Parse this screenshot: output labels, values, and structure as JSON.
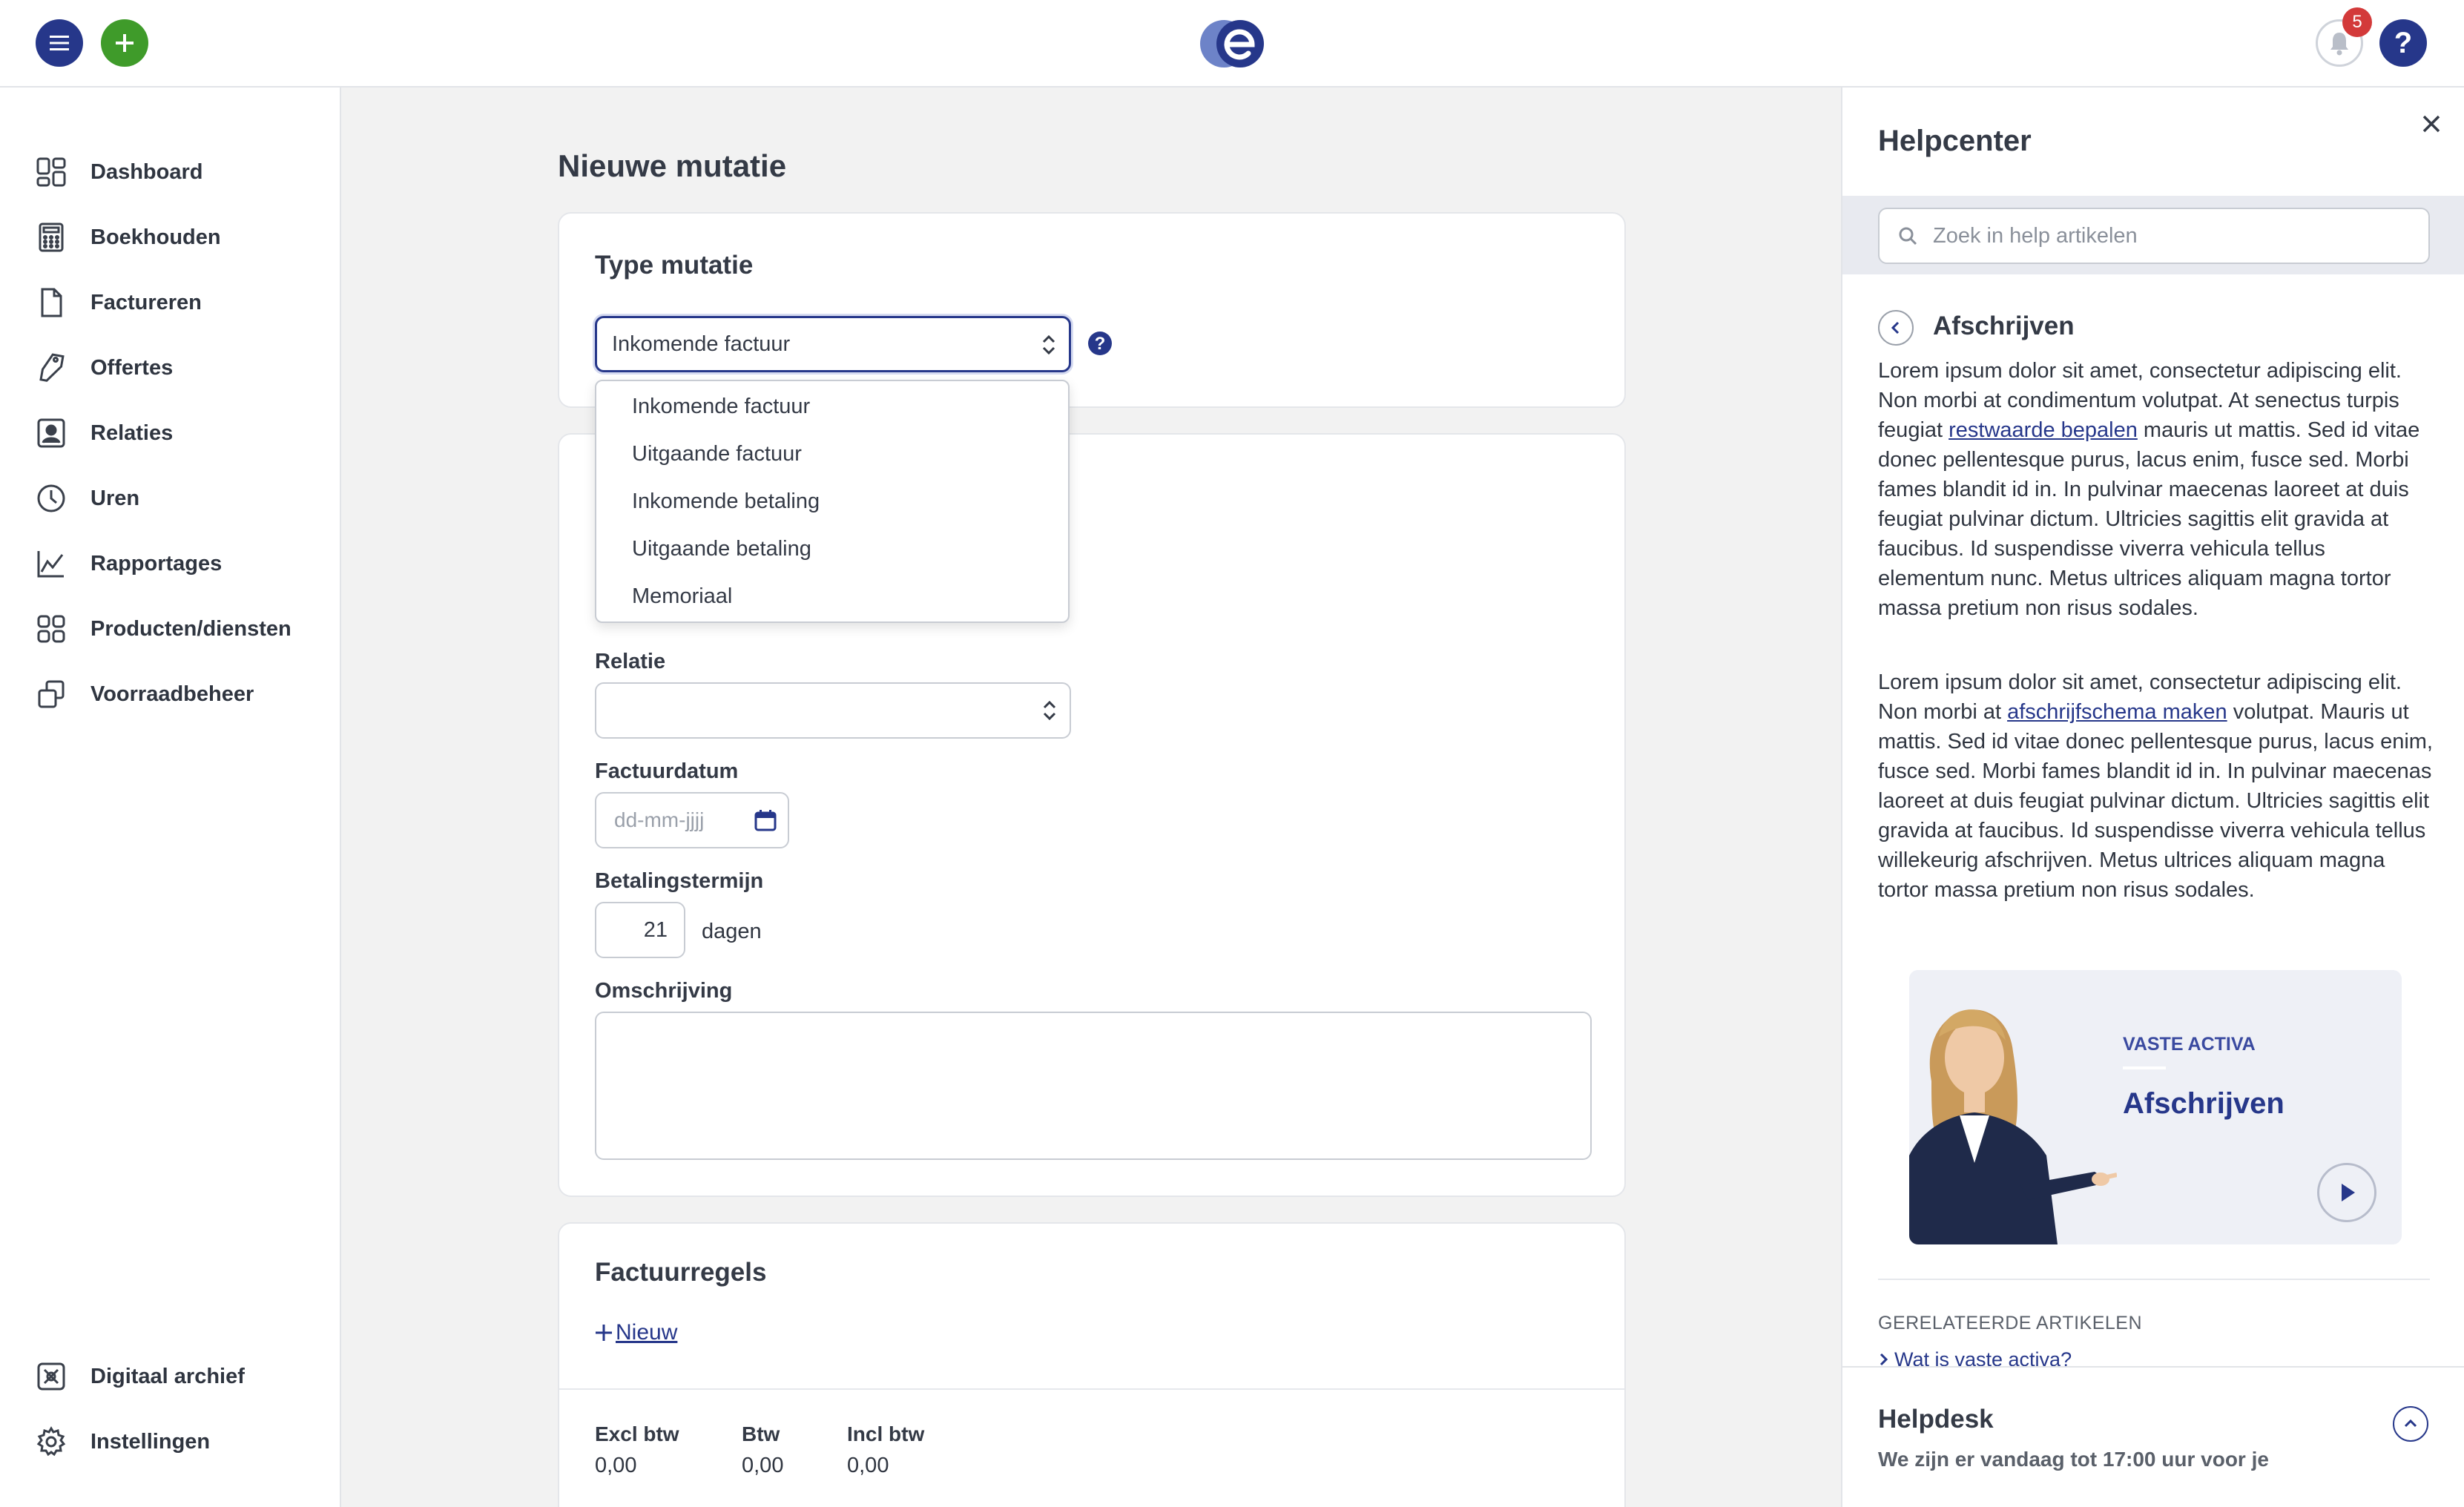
{
  "topbar": {
    "notification_count": "5",
    "help_label": "?"
  },
  "sidebar": {
    "items": [
      {
        "label": "Dashboard",
        "icon": "dashboard-icon"
      },
      {
        "label": "Boekhouden",
        "icon": "calculator-icon"
      },
      {
        "label": "Factureren",
        "icon": "document-icon"
      },
      {
        "label": "Offertes",
        "icon": "tag-icon"
      },
      {
        "label": "Relaties",
        "icon": "contact-icon"
      },
      {
        "label": "Uren",
        "icon": "clock-icon"
      },
      {
        "label": "Rapportages",
        "icon": "chart-icon"
      },
      {
        "label": "Producten/diensten",
        "icon": "grid-icon"
      },
      {
        "label": "Voorraadbeheer",
        "icon": "stack-icon"
      }
    ],
    "bottom_items": [
      {
        "label": "Digitaal archief",
        "icon": "archive-icon"
      },
      {
        "label": "Instellingen",
        "icon": "gear-icon"
      }
    ]
  },
  "main": {
    "page_title": "Nieuwe mutatie",
    "type_card": {
      "title": "Type mutatie",
      "selected": "Inkomende factuur",
      "options": [
        "Inkomende factuur",
        "Uitgaande factuur",
        "Inkomende betaling",
        "Uitgaande betaling",
        "Memoriaal"
      ]
    },
    "form": {
      "relatie_label": "Relatie",
      "relatie_value": "",
      "factuurdatum_label": "Factuurdatum",
      "factuurdatum_placeholder": "dd-mm-jjjj",
      "betalingstermijn_label": "Betalingstermijn",
      "betalingstermijn_value": "21",
      "betalingstermijn_unit": "dagen",
      "omschrijving_label": "Omschrijving"
    },
    "factuurregels": {
      "title": "Factuurregels",
      "new_label": "Nieuw",
      "totals": [
        {
          "label": "Excl btw",
          "value": "0,00"
        },
        {
          "label": "Btw",
          "value": "0,00"
        },
        {
          "label": "Incl btw",
          "value": "0,00"
        }
      ]
    }
  },
  "help": {
    "title": "Helpcenter",
    "search_placeholder": "Zoek in help artikelen",
    "article_title": "Afschrijven",
    "p1_a": "Lorem ipsum dolor sit amet, consectetur adipiscing elit. Non morbi at condimentum volutpat. At senectus turpis feugiat ",
    "p1_link": "restwaarde bepalen",
    "p1_b": " mauris ut mattis. Sed id vitae donec pellentesque purus, lacus enim, fusce sed. Morbi fames blandit id in. In pulvinar maecenas laoreet at duis feugiat pulvinar dictum. Ultricies sagittis elit gravida at faucibus. Id suspendisse viverra vehicula tellus elementum nunc. Metus ultrices aliquam magna tortor massa pretium non risus sodales.",
    "p2_a": "Lorem ipsum dolor sit amet, consectetur adipiscing elit. Non morbi at ",
    "p2_link": "afschrijfschema maken",
    "p2_b": " volutpat. Mauris ut mattis. Sed id vitae donec pellentesque purus, lacus enim, fusce sed. Morbi fames blandit id in. In pulvinar maecenas laoreet at duis feugiat pulvinar dictum. Ultricies sagittis elit gravida at faucibus. Id suspendisse viverra vehicula tellus willekeurig afschrijven. Metus ultrices aliquam magna tortor massa pretium non risus sodales.",
    "video_kicker": "VASTE ACTIVA",
    "video_title": "Afschrijven",
    "related_label": "GERELATEERDE ARTIKELEN",
    "related_link": "Wat is vaste activa?",
    "helpdesk_title": "Helpdesk",
    "helpdesk_sub": "We zijn er vandaag tot 17:00 uur voor je"
  },
  "colors": {
    "brand_blue": "#26378a",
    "add_green": "#3f9b2a",
    "badge_red": "#d33a3a"
  }
}
